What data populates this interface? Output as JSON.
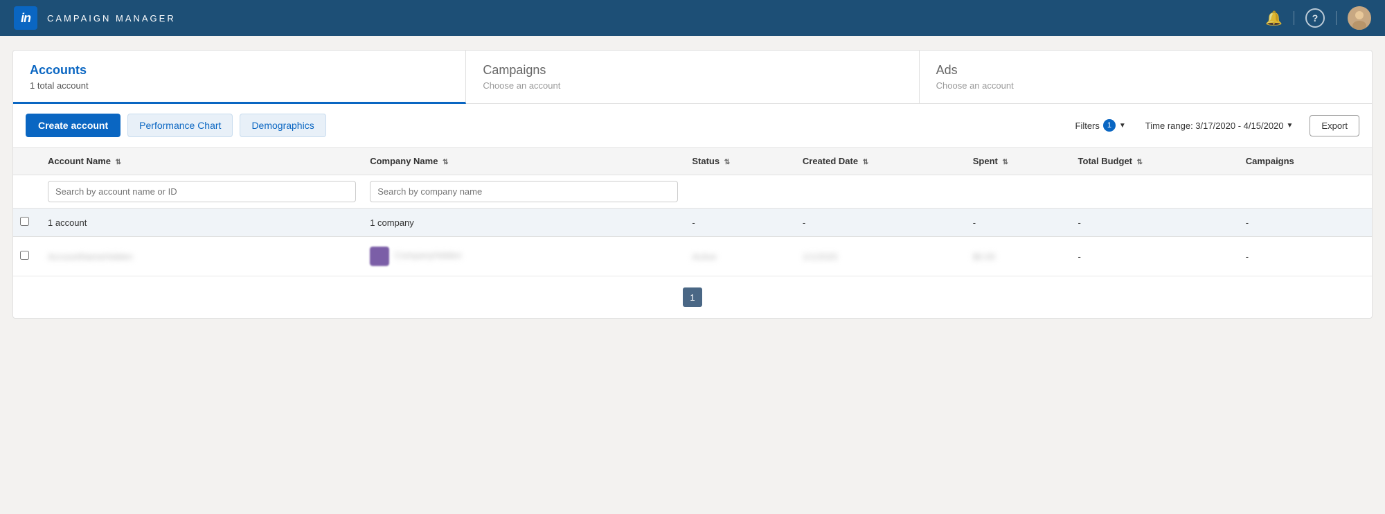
{
  "app": {
    "title": "CAMPAIGN MANAGER",
    "logo_letter": "in"
  },
  "topnav": {
    "bell_icon": "🔔",
    "help_icon": "?",
    "notifications_label": "Notifications",
    "help_label": "Help"
  },
  "tabs": [
    {
      "id": "accounts",
      "label": "Accounts",
      "sublabel": "1 total account",
      "active": true
    },
    {
      "id": "campaigns",
      "label": "Campaigns",
      "sublabel": "Choose an account",
      "active": false
    },
    {
      "id": "ads",
      "label": "Ads",
      "sublabel": "Choose an account",
      "active": false
    }
  ],
  "toolbar": {
    "create_account_label": "Create account",
    "performance_chart_label": "Performance Chart",
    "demographics_label": "Demographics",
    "filters_label": "Filters",
    "filters_count": "1",
    "time_range_label": "Time range: 3/17/2020 - 4/15/2020",
    "export_label": "Export"
  },
  "table": {
    "columns": [
      {
        "id": "account_name",
        "label": "Account Name",
        "sortable": true
      },
      {
        "id": "company_name",
        "label": "Company Name",
        "sortable": true
      },
      {
        "id": "status",
        "label": "Status",
        "sortable": true
      },
      {
        "id": "created_date",
        "label": "Created Date",
        "sortable": true
      },
      {
        "id": "spent",
        "label": "Spent",
        "sortable": true
      },
      {
        "id": "total_budget",
        "label": "Total Budget",
        "sortable": true
      },
      {
        "id": "campaigns",
        "label": "Campaigns",
        "sortable": false
      }
    ],
    "search_placeholders": {
      "account_name": "Search by account name or ID",
      "company_name": "Search by company name"
    },
    "summary_row": {
      "account_count": "1 account",
      "company_count": "1 company",
      "status": "-",
      "created_date": "-",
      "spent": "-",
      "total_budget": "-",
      "campaigns": "-"
    },
    "data_rows": [
      {
        "account_name": "██████████████",
        "company_name": "██████████████",
        "has_logo": true,
        "status": "████████",
        "created_date": "████████",
        "spent": "████",
        "total_budget": "-",
        "campaigns": "-"
      }
    ]
  },
  "pagination": {
    "current_page": "1"
  }
}
